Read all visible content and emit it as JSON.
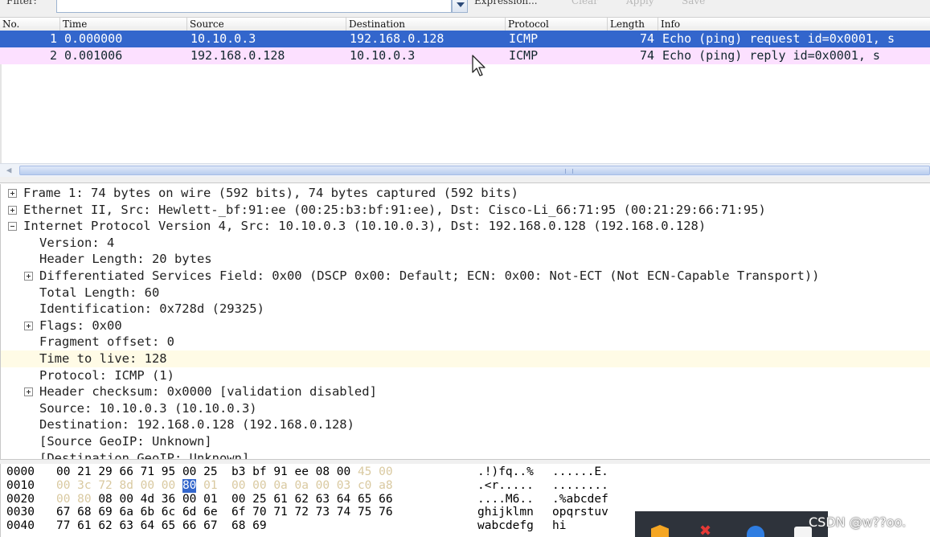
{
  "toolbar": {
    "filter_label": "Filter:",
    "filter_value": "",
    "expression_label": "Expression...",
    "clear_label": "Clear",
    "apply_label": "Apply",
    "save_label": "Save"
  },
  "packet_list": {
    "columns": [
      "No.",
      "Time",
      "Source",
      "Destination",
      "Protocol",
      "Length",
      "Info"
    ],
    "rows": [
      {
        "no": "1",
        "time": "0.000000",
        "source": "10.10.0.3",
        "destination": "192.168.0.128",
        "protocol": "ICMP",
        "length": "74",
        "info": "Echo (ping) request  id=0x0001, s"
      },
      {
        "no": "2",
        "time": "0.001006",
        "source": "192.168.0.128",
        "destination": "10.10.0.3",
        "protocol": "ICMP",
        "length": "74",
        "info": "Echo (ping) reply    id=0x0001, s"
      }
    ],
    "selected_row": 1,
    "colors": {
      "selected_bg": "#3366cc",
      "icmp_bg": "#fce0ff"
    }
  },
  "details": [
    {
      "text": "Frame 1: 74 bytes on wire (592 bits), 74 bytes captured (592 bits)",
      "indent": 0,
      "expander": "plus"
    },
    {
      "text": "Ethernet II, Src: Hewlett-_bf:91:ee (00:25:b3:bf:91:ee), Dst: Cisco-Li_66:71:95 (00:21:29:66:71:95)",
      "indent": 0,
      "expander": "plus"
    },
    {
      "text": "Internet Protocol Version 4, Src: 10.10.0.3 (10.10.0.3), Dst: 192.168.0.128 (192.168.0.128)",
      "indent": 0,
      "expander": "minus"
    },
    {
      "text": "Version: 4",
      "indent": 1,
      "expander": "none"
    },
    {
      "text": "Header Length: 20 bytes",
      "indent": 1,
      "expander": "none"
    },
    {
      "text": "Differentiated Services Field: 0x00 (DSCP 0x00: Default; ECN: 0x00: Not-ECT (Not ECN-Capable Transport))",
      "indent": 1,
      "expander": "plus"
    },
    {
      "text": "Total Length: 60",
      "indent": 1,
      "expander": "none"
    },
    {
      "text": "Identification: 0x728d (29325)",
      "indent": 1,
      "expander": "none"
    },
    {
      "text": "Flags: 0x00",
      "indent": 1,
      "expander": "plus"
    },
    {
      "text": "Fragment offset: 0",
      "indent": 1,
      "expander": "none"
    },
    {
      "text": "Time to live: 128",
      "indent": 1,
      "expander": "none",
      "highlighted": true
    },
    {
      "text": "Protocol: ICMP (1)",
      "indent": 1,
      "expander": "none"
    },
    {
      "text": "Header checksum: 0x0000 [validation disabled]",
      "indent": 1,
      "expander": "plus"
    },
    {
      "text": "Source: 10.10.0.3 (10.10.0.3)",
      "indent": 1,
      "expander": "none"
    },
    {
      "text": "Destination: 192.168.0.128 (192.168.0.128)",
      "indent": 1,
      "expander": "none"
    },
    {
      "text": "[Source GeoIP: Unknown]",
      "indent": 1,
      "expander": "none"
    },
    {
      "text": "[Destination GeoIP: Unknown]",
      "indent": 1,
      "expander": "none"
    }
  ],
  "hex": [
    {
      "offset": "0000",
      "bytes": [
        "00",
        "21",
        "29",
        "66",
        "71",
        "95",
        "00",
        "25",
        "b3",
        "bf",
        "91",
        "ee",
        "08",
        "00",
        "45",
        "00"
      ],
      "ascii_a": ".!)fq..%",
      "ascii_b": "......E."
    },
    {
      "offset": "0010",
      "bytes": [
        "00",
        "3c",
        "72",
        "8d",
        "00",
        "00",
        "80",
        "01",
        "00",
        "00",
        "0a",
        "0a",
        "00",
        "03",
        "c0",
        "a8"
      ],
      "ascii_a": ".<r.....",
      "ascii_b": "........"
    },
    {
      "offset": "0020",
      "bytes": [
        "00",
        "80",
        "08",
        "00",
        "4d",
        "36",
        "00",
        "01",
        "00",
        "25",
        "61",
        "62",
        "63",
        "64",
        "65",
        "66"
      ],
      "ascii_a": "....M6..",
      "ascii_b": ".%abcdef"
    },
    {
      "offset": "0030",
      "bytes": [
        "67",
        "68",
        "69",
        "6a",
        "6b",
        "6c",
        "6d",
        "6e",
        "6f",
        "70",
        "71",
        "72",
        "73",
        "74",
        "75",
        "76"
      ],
      "ascii_a": "ghijklmn",
      "ascii_b": "opqrstuv"
    },
    {
      "offset": "0040",
      "bytes": [
        "77",
        "61",
        "62",
        "63",
        "64",
        "65",
        "66",
        "67",
        "68",
        "69"
      ],
      "ascii_a": "wabcdefg",
      "ascii_b": "hi"
    }
  ],
  "hex_style": {
    "ip_header_range": {
      "start": 14,
      "end": 34
    },
    "selected_byte": 22
  },
  "watermark": "CSDN @w??oo."
}
